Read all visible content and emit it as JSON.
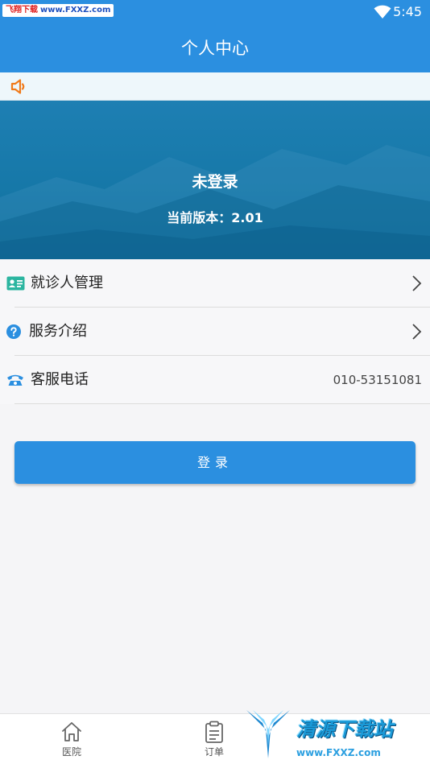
{
  "status_bar": {
    "watermark_left_a": "飞翔下载",
    "watermark_left_b": "www.FXXZ.com",
    "time": "5:45",
    "wifi_icon": "wifi-icon"
  },
  "header": {
    "title": "个人中心"
  },
  "notice": {
    "icon": "speaker-icon"
  },
  "banner": {
    "status": "未登录",
    "version": "当前版本：2.01"
  },
  "menu": {
    "items": [
      {
        "label": "就诊人管理",
        "icon": "id-card-icon",
        "has_arrow": true
      },
      {
        "label": "服务介绍",
        "icon": "help-circle-icon",
        "has_arrow": true
      },
      {
        "label": "客服电话",
        "icon": "phone-icon",
        "value": "010-53151081"
      }
    ]
  },
  "login_button": {
    "label": "登录"
  },
  "tabbar": {
    "tabs": [
      {
        "label": "医院",
        "icon": "home-icon"
      },
      {
        "label": "订单",
        "icon": "clipboard-icon"
      }
    ]
  },
  "watermark_bottom": {
    "title": "清源下载站",
    "url": "www.FXXZ.com"
  },
  "colors": {
    "primary": "#2b8fe0",
    "notice_icon": "#f07a1a",
    "id_card_icon": "#2bb5a0",
    "help_icon": "#2b8fe0",
    "phone_icon": "#2b8fe0"
  }
}
